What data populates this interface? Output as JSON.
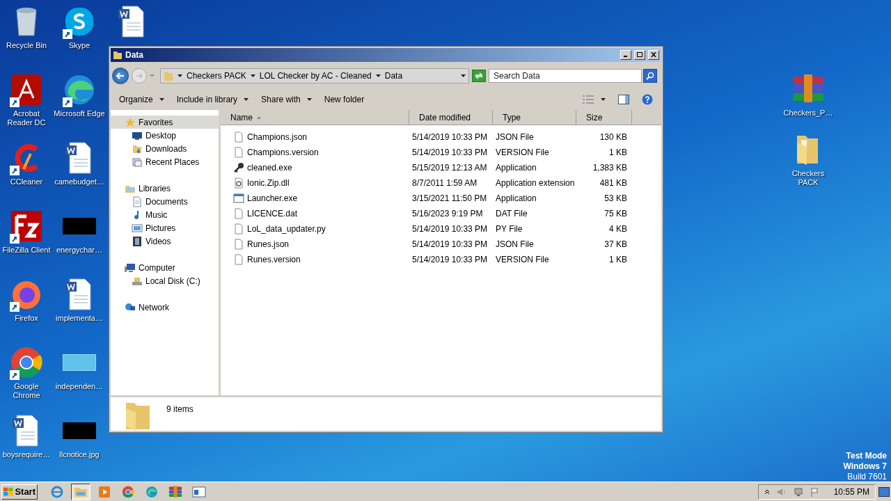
{
  "desktop": {
    "icons": [
      {
        "label": "Recycle Bin",
        "kind": "recycle",
        "shortcut": false
      },
      {
        "label": "Acrobat Reader DC",
        "kind": "acrobat",
        "shortcut": true
      },
      {
        "label": "CCleaner",
        "kind": "ccleaner",
        "shortcut": true
      },
      {
        "label": "FileZilla Client",
        "kind": "filezilla",
        "shortcut": true
      },
      {
        "label": "Firefox",
        "kind": "firefox",
        "shortcut": true
      },
      {
        "label": "Google Chrome",
        "kind": "chrome",
        "shortcut": true
      },
      {
        "label": "boysrequire…",
        "kind": "word",
        "shortcut": false
      },
      {
        "label": "Skype",
        "kind": "skype",
        "shortcut": true
      },
      {
        "label": "Microsoft Edge",
        "kind": "edge",
        "shortcut": true
      },
      {
        "label": "camebudget…",
        "kind": "word",
        "shortcut": false
      },
      {
        "label": "energychar…",
        "kind": "dark",
        "shortcut": false
      },
      {
        "label": "implementa…",
        "kind": "word",
        "shortcut": false
      },
      {
        "label": "independen…",
        "kind": "blank",
        "shortcut": false
      },
      {
        "label": "llcnotice.jpg",
        "kind": "dark",
        "shortcut": false
      },
      {
        "kind": "word",
        "shortcut": false
      }
    ],
    "right_icons": [
      {
        "label": "Checkers_P…",
        "kind": "winrar"
      },
      {
        "label": "Checkers PACK",
        "kind": "folder"
      }
    ],
    "os_info": [
      "Test Mode",
      "Windows 7",
      "Build 7601"
    ]
  },
  "window": {
    "title": "Data",
    "breadcrumb": [
      "Checkers PACK",
      "LOL Checker by AC - Cleaned",
      "Data"
    ],
    "search": {
      "placeholder": "Search Data"
    },
    "toolbar": [
      {
        "label": "Organize",
        "menu": true
      },
      {
        "label": "Include in library",
        "menu": true
      },
      {
        "label": "Share with",
        "menu": true
      },
      {
        "label": "New folder",
        "menu": false
      }
    ],
    "nav": [
      {
        "label": "Favorites",
        "kind": "star",
        "selected": true,
        "children": [
          {
            "label": "Desktop",
            "kind": "desktop",
            "selected": false
          },
          {
            "label": "Downloads",
            "kind": "downloads",
            "selected": false
          },
          {
            "label": "Recent Places",
            "kind": "recent",
            "selected": false
          }
        ]
      },
      {
        "label": "Libraries",
        "kind": "libraries",
        "selected": false,
        "children": [
          {
            "label": "Documents",
            "kind": "documents",
            "selected": false
          },
          {
            "label": "Music",
            "kind": "music",
            "selected": false
          },
          {
            "label": "Pictures",
            "kind": "pictures",
            "selected": false
          },
          {
            "label": "Videos",
            "kind": "videos",
            "selected": false
          }
        ]
      },
      {
        "label": "Computer",
        "kind": "computer",
        "selected": false,
        "children": [
          {
            "label": "Local Disk (C:)",
            "kind": "disk",
            "selected": false
          }
        ]
      },
      {
        "label": "Network",
        "kind": "network",
        "selected": false
      }
    ],
    "columns": [
      {
        "label": "Name",
        "sorted": true
      },
      {
        "label": "Date modified",
        "sorted": false
      },
      {
        "label": "Type",
        "sorted": false
      },
      {
        "label": "Size",
        "sorted": false
      }
    ],
    "rows": [
      {
        "name": "Champions.json",
        "date": "5/14/2019 10:33 PM",
        "type": "JSON File",
        "size": "130 KB",
        "kind": "doc"
      },
      {
        "name": "Champions.version",
        "date": "5/14/2019 10:33 PM",
        "type": "VERSION File",
        "size": "1 KB",
        "kind": "doc"
      },
      {
        "name": "cleaned.exe",
        "date": "5/15/2019 12:13 AM",
        "type": "Application",
        "size": "1,383 KB",
        "kind": "key"
      },
      {
        "name": "Ionic.Zip.dll",
        "date": "8/7/2011 1:59 AM",
        "type": "Application extension",
        "size": "481 KB",
        "kind": "dll"
      },
      {
        "name": "Launcher.exe",
        "date": "3/15/2021 11:50 PM",
        "type": "Application",
        "size": "53 KB",
        "kind": "exe"
      },
      {
        "name": "LICENCE.dat",
        "date": "5/16/2023 9:19 PM",
        "type": "DAT File",
        "size": "75 KB",
        "kind": "doc"
      },
      {
        "name": "LoL_data_updater.py",
        "date": "5/14/2019 10:33 PM",
        "type": "PY File",
        "size": "4 KB",
        "kind": "doc"
      },
      {
        "name": "Runes.json",
        "date": "5/14/2019 10:33 PM",
        "type": "JSON File",
        "size": "37 KB",
        "kind": "doc"
      },
      {
        "name": "Runes.version",
        "date": "5/14/2019 10:33 PM",
        "type": "VERSION File",
        "size": "1 KB",
        "kind": "doc"
      }
    ],
    "status": "9 items"
  },
  "taskbar": {
    "start": "Start",
    "items": [
      {
        "kind": "ie",
        "active": false
      },
      {
        "kind": "explorer",
        "active": true
      },
      {
        "kind": "media",
        "active": false
      },
      {
        "kind": "chrome",
        "active": false
      },
      {
        "kind": "edge",
        "active": false
      },
      {
        "kind": "winrar",
        "active": false
      },
      {
        "kind": "window",
        "active": false
      }
    ],
    "clock": "10:55 PM"
  }
}
